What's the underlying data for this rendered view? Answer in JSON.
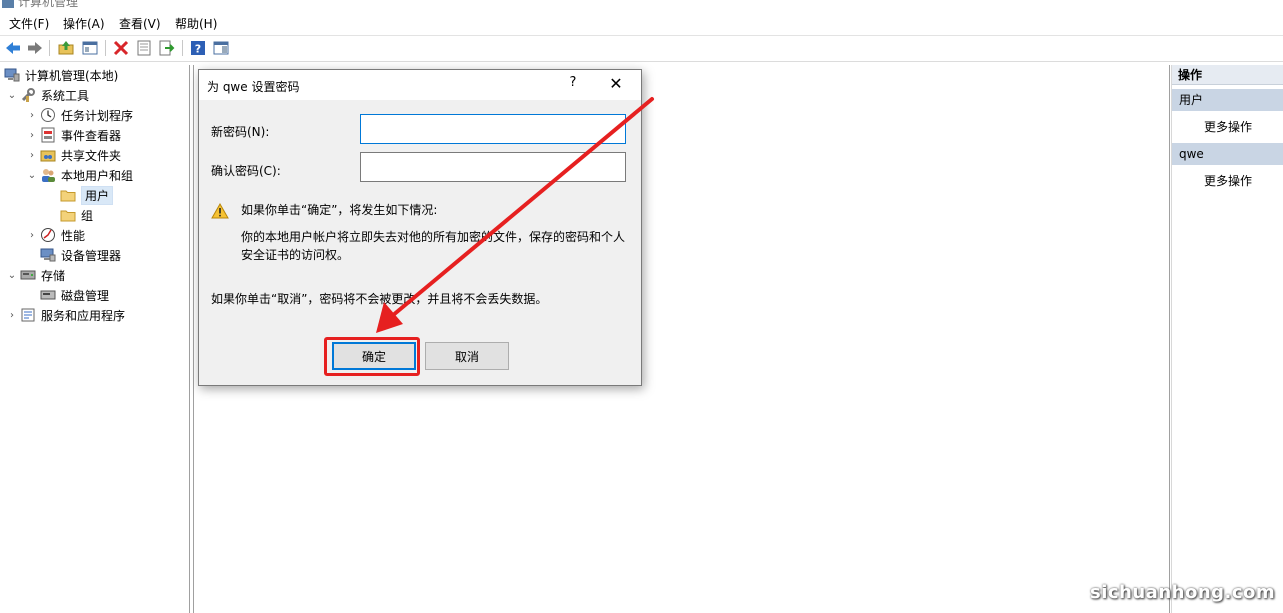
{
  "window": {
    "title": "计算机管理"
  },
  "menu": [
    "文件(F)",
    "操作(A)",
    "查看(V)",
    "帮助(H)"
  ],
  "toolbar": {
    "buttons": [
      "back-icon",
      "forward-icon",
      "up-folder-icon",
      "show-hide-tree-icon",
      "delete-icon",
      "properties-icon",
      "export-icon",
      "help-icon",
      "action-pane-icon"
    ]
  },
  "tree": {
    "root": "计算机管理(本地)",
    "system_tools": "系统工具",
    "task_scheduler": "任务计划程序",
    "event_viewer": "事件查看器",
    "shared_folders": "共享文件夹",
    "local_users_groups": "本地用户和组",
    "users": "用户",
    "groups": "组",
    "performance": "性能",
    "device_manager": "设备管理器",
    "storage": "存储",
    "disk_management": "磁盘管理",
    "services_apps": "服务和应用程序"
  },
  "actions": {
    "header": "操作",
    "section1": "用户",
    "section1_item": "更多操作",
    "section2": "qwe",
    "section2_item": "更多操作"
  },
  "dialog": {
    "title": "为 qwe 设置密码",
    "help": "?",
    "close": "✕",
    "new_password_label": "新密码(N):",
    "new_password_value": "",
    "confirm_password_label": "确认密码(C):",
    "confirm_password_value": "",
    "warning_heading": "如果你单击“确定”，将发生如下情况:",
    "warning_line1": "你的本地用户帐户将立即失去对他的所有加密的文件，保存的密码和个人",
    "warning_line2": "安全证书的访问权。",
    "cancel_note": "如果你单击“取消”，密码将不会被更改，并且将不会丢失数据。",
    "ok_label": "确定",
    "cancel_label": "取消"
  },
  "watermark": "sichuanhong.com",
  "colors": {
    "accent": "#0078d7",
    "annotation_red": "#e62020",
    "action_section": "#c9d5e4"
  }
}
